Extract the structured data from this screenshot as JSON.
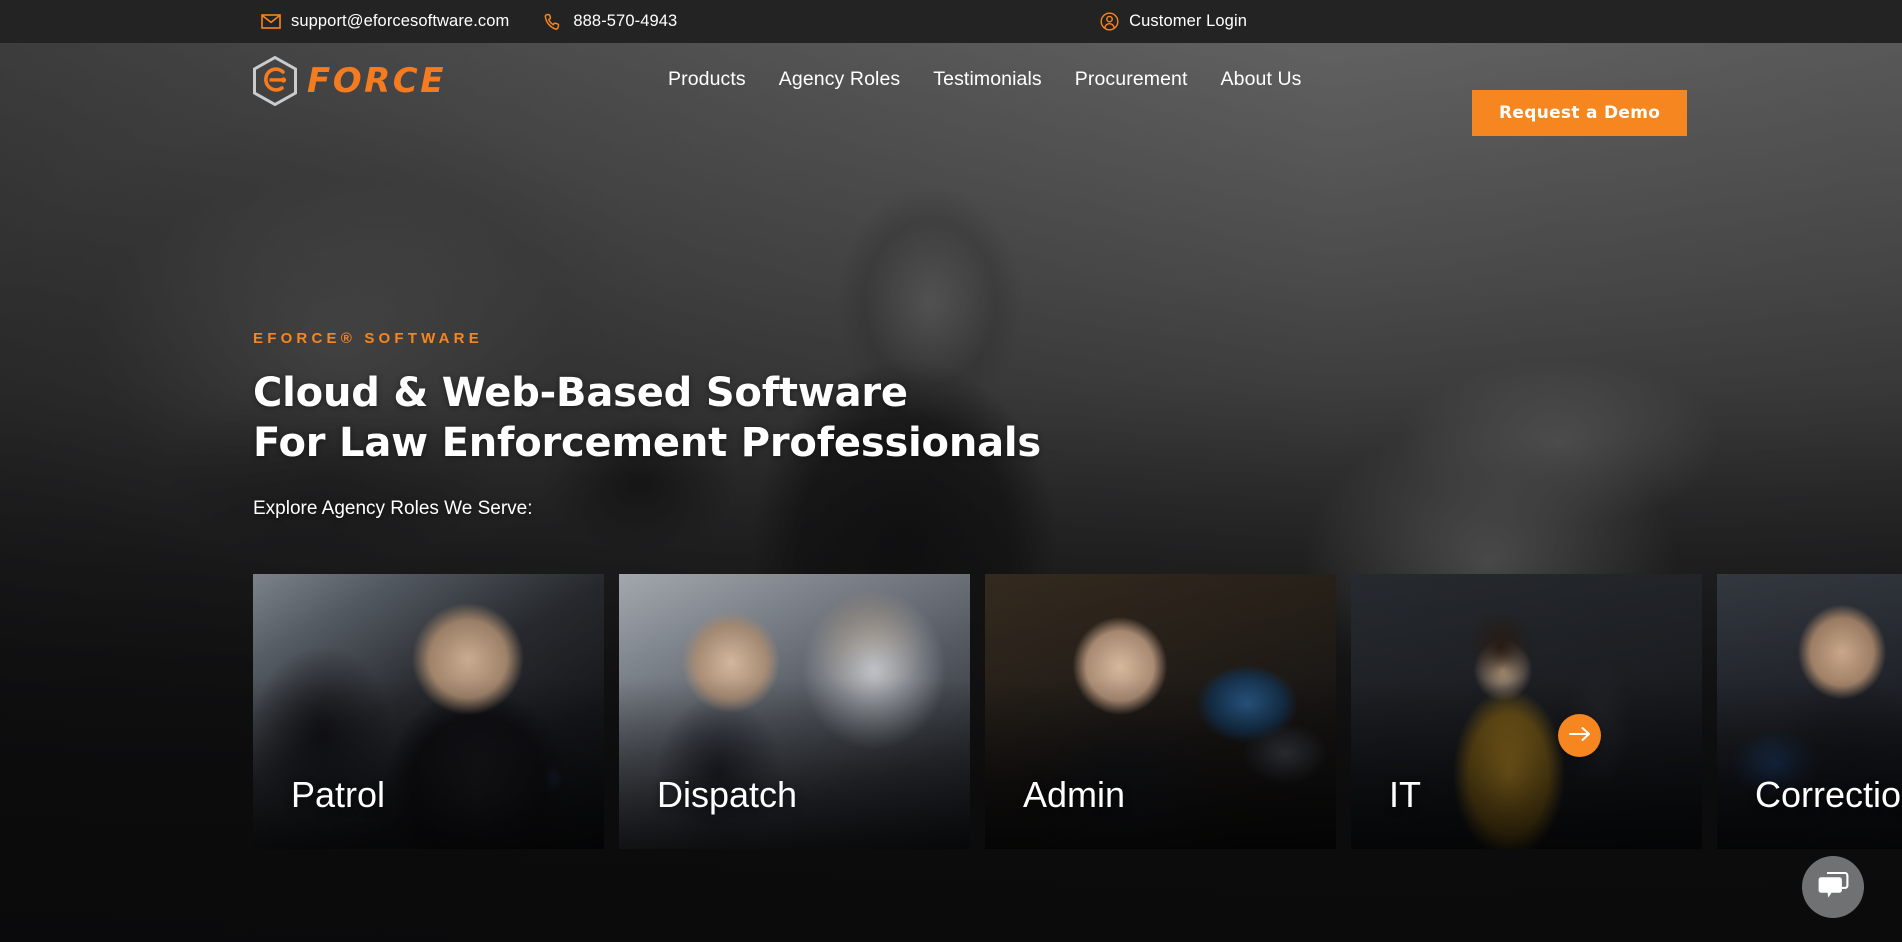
{
  "topbar": {
    "email": "support@eforcesoftware.com",
    "phone": "888-570-4943",
    "login_label": "Customer Login",
    "email_icon": "envelope-icon",
    "phone_icon": "phone-icon",
    "login_icon": "user-circle-icon"
  },
  "nav": {
    "logo_text": "FORCE",
    "logo_mark": "hexagon-e-icon",
    "links": [
      {
        "label": "Products"
      },
      {
        "label": "Agency Roles"
      },
      {
        "label": "Testimonials"
      },
      {
        "label": "Procurement"
      },
      {
        "label": "About Us"
      }
    ],
    "cta_label": "Request a Demo"
  },
  "hero": {
    "eyebrow": "EFORCE® SOFTWARE",
    "headline_line1": "Cloud & Web-Based Software",
    "headline_line2": "For Law Enforcement Professionals",
    "subline": "Explore Agency Roles We Serve:"
  },
  "carousel": {
    "cards": [
      {
        "label": "Patrol"
      },
      {
        "label": "Dispatch"
      },
      {
        "label": "Admin"
      },
      {
        "label": "IT"
      },
      {
        "label": "Corrections"
      }
    ],
    "next_icon": "arrow-right-icon"
  },
  "chat": {
    "icon": "chat-bubble-icon"
  },
  "colors": {
    "brand_orange": "#F6861F",
    "logo_orange": "#F47B20",
    "topbar_bg": "#232323",
    "text_white": "#FFFFFF",
    "chat_gray": "#6F7173"
  }
}
